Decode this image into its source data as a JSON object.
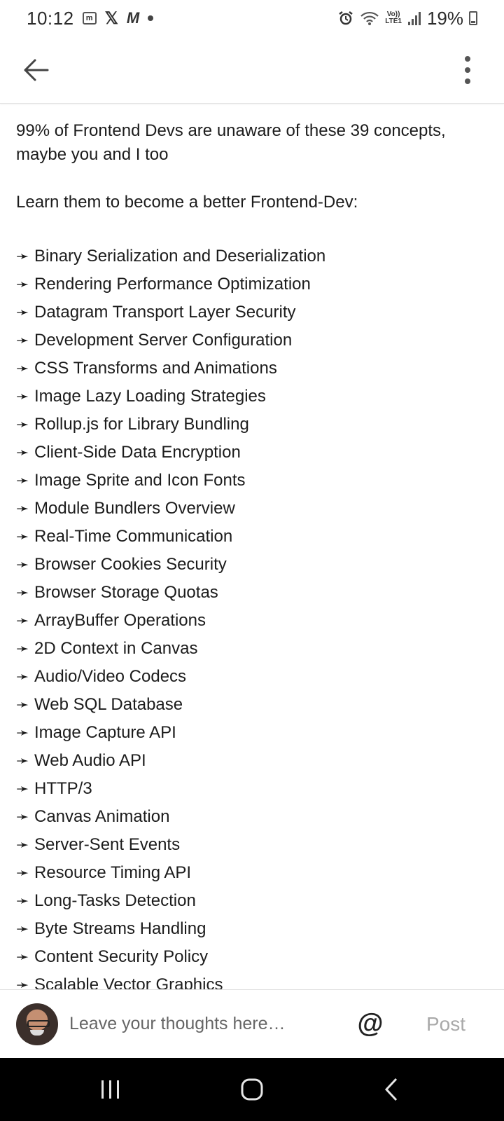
{
  "status_bar": {
    "time": "10:12",
    "battery": "19%",
    "icons": [
      "messages-icon",
      "x-icon",
      "m-icon",
      "dot-icon",
      "alarm-icon",
      "wifi-icon",
      "volte-icon",
      "signal-icon",
      "battery-icon"
    ],
    "volte_label": "Vo))\nLTE1"
  },
  "app_bar": {
    "back_icon": "arrow-left-icon",
    "menu_icon": "more-vert-icon"
  },
  "post": {
    "intro": "99% of Frontend Devs are unaware of these 39 concepts, maybe you and I too",
    "cta": "Learn them to become a better Frontend-Dev:",
    "arrow": "➛",
    "concepts": [
      "Binary Serialization and Deserialization",
      "Rendering Performance Optimization",
      "Datagram Transport Layer Security",
      "Development Server Configuration",
      "CSS Transforms and Animations",
      "Image Lazy Loading Strategies",
      "Rollup.js for Library Bundling",
      "Client-Side Data Encryption",
      "Image Sprite and Icon Fonts",
      "Module Bundlers Overview",
      "Real-Time Communication",
      "Browser Cookies Security",
      "Browser Storage Quotas",
      "ArrayBuffer Operations",
      "2D Context in Canvas",
      "Audio/Video Codecs",
      "Web SQL Database",
      "Image Capture API",
      "Web Audio API",
      "HTTP/3",
      "Canvas Animation",
      "Server-Sent Events",
      "Resource Timing API",
      "Long-Tasks Detection",
      "Byte Streams Handling",
      "Content Security Policy",
      "Scalable Vector Graphics"
    ]
  },
  "comment_bar": {
    "placeholder": "Leave your thoughts here…",
    "mention_label": "@",
    "post_label": "Post",
    "post_color_disabled": "#a9a9a9"
  },
  "nav_bar": {
    "items": [
      "recents-icon",
      "home-icon",
      "back-icon"
    ],
    "background": "#000000"
  }
}
